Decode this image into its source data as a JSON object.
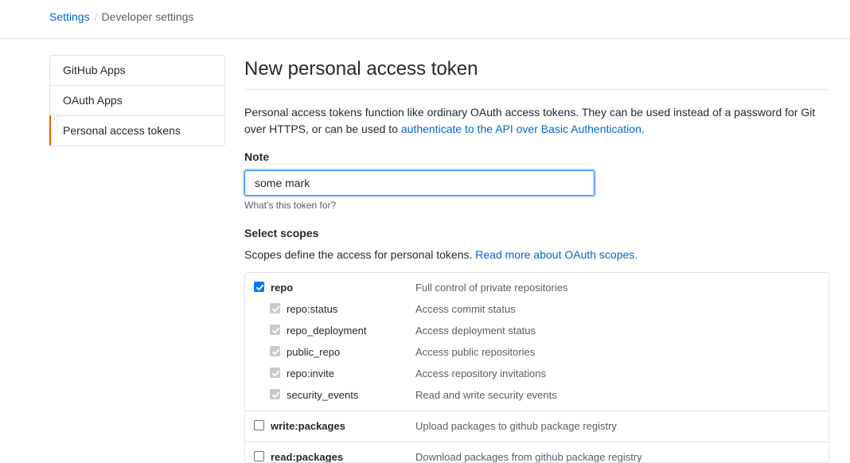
{
  "breadcrumb": {
    "parent": "Settings",
    "separator": "/",
    "current": "Developer settings"
  },
  "menu": {
    "items": [
      {
        "label": "GitHub Apps"
      },
      {
        "label": "OAuth Apps"
      },
      {
        "label": "Personal access tokens"
      }
    ],
    "selected_index": 2,
    "selected_accent": "#e36209"
  },
  "page": {
    "title": "New personal access token",
    "intro_text": "Personal access tokens function like ordinary OAuth access tokens. They can be used instead of a password for Git over HTTPS, or can be used to ",
    "intro_link": "authenticate to the API over Basic Authentication",
    "intro_end": "."
  },
  "note": {
    "label": "Note",
    "value": "some mark",
    "hint": "What’s this token for?"
  },
  "scopes": {
    "label": "Select scopes",
    "desc_text": "Scopes define the access for personal tokens. ",
    "desc_link": "Read more about OAuth scopes.",
    "groups": [
      {
        "name": "repo",
        "description": "Full control of private repositories",
        "checked": true,
        "children": [
          {
            "name": "repo:status",
            "description": "Access commit status"
          },
          {
            "name": "repo_deployment",
            "description": "Access deployment status"
          },
          {
            "name": "public_repo",
            "description": "Access public repositories"
          },
          {
            "name": "repo:invite",
            "description": "Access repository invitations"
          },
          {
            "name": "security_events",
            "description": "Read and write security events"
          }
        ]
      },
      {
        "name": "write:packages",
        "description": "Upload packages to github package registry",
        "checked": false,
        "children": []
      },
      {
        "name": "read:packages",
        "description": "Download packages from github package registry",
        "checked": false,
        "children": []
      }
    ]
  },
  "colors": {
    "link": "#0366d6",
    "checkbox": "#0075ff",
    "focus_border": "#2188ff"
  }
}
